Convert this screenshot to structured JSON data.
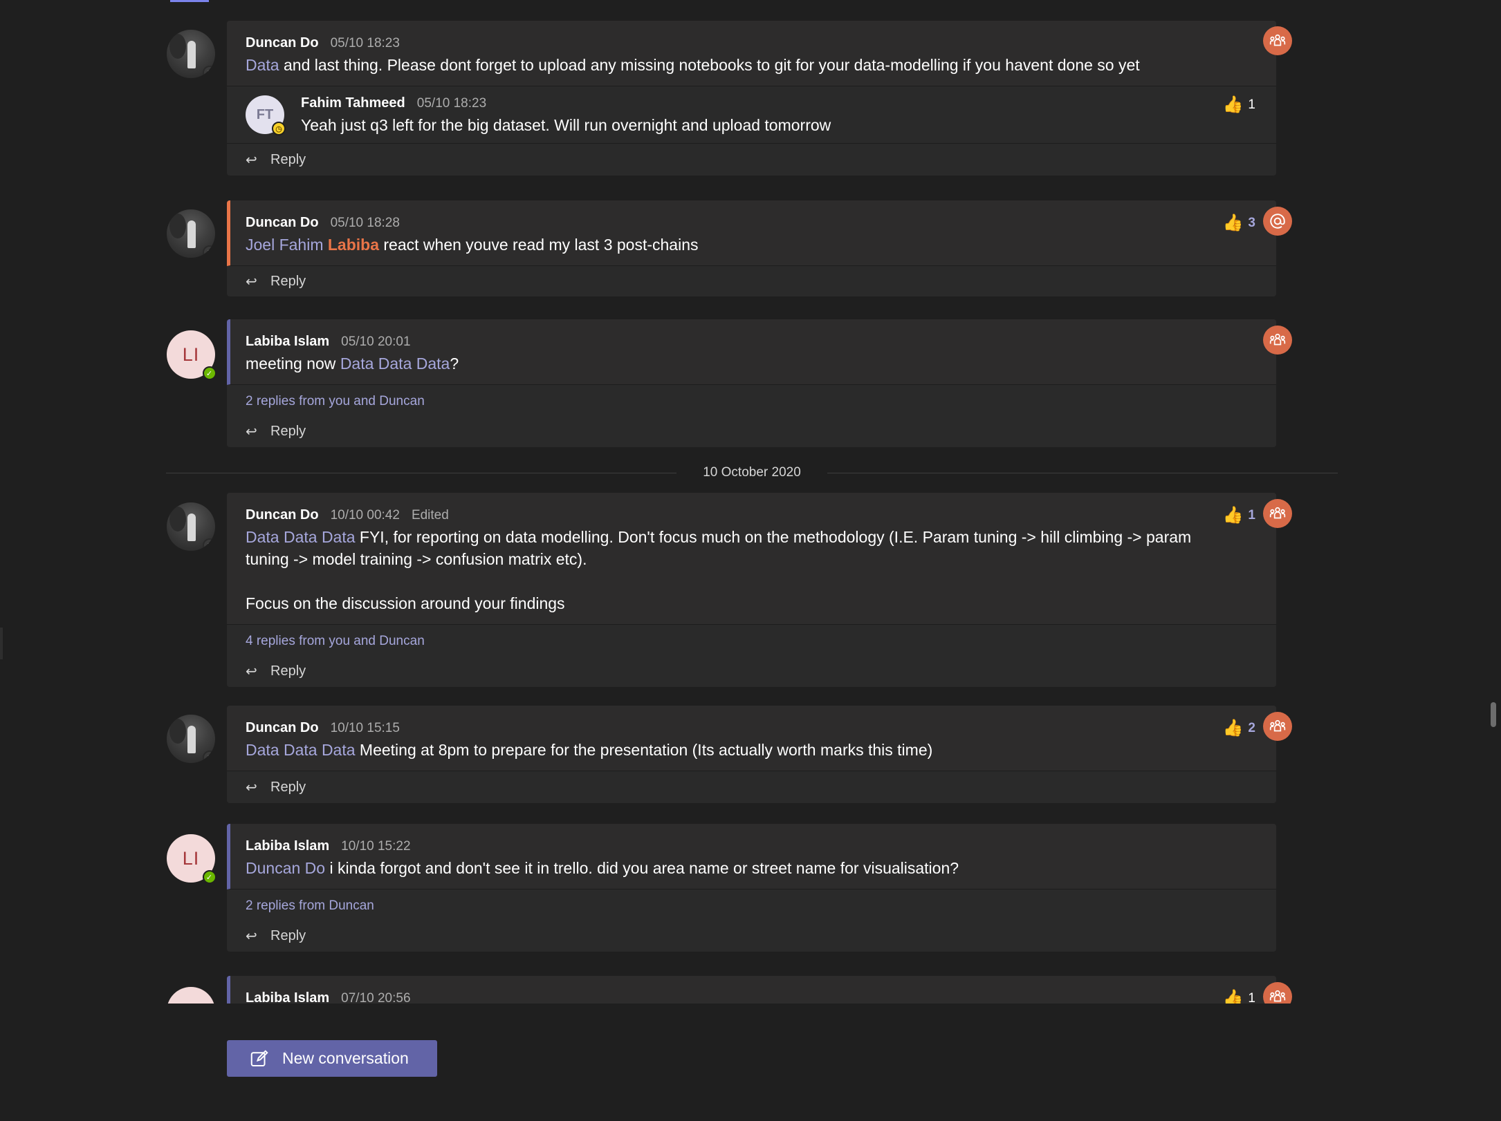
{
  "date_divider": "10 October 2020",
  "new_conversation_label": "New conversation",
  "reply_label": "Reply",
  "posts": [
    {
      "author": "Duncan Do",
      "time": "05/10 18:23",
      "mention": "Data",
      "text": " and last thing. Please dont forget to upload any missing notebooks to git for your data-modelling if you havent done so yet",
      "replies": [
        {
          "initials": "FT",
          "author": "Fahim Tahmeed",
          "time": "05/10 18:23",
          "text": "Yeah just q3 left for the big dataset. Will run overnight and upload tomorrow",
          "reaction_count": "1"
        }
      ]
    },
    {
      "author": "Duncan Do",
      "time": "05/10 18:28",
      "mention_a": "Joel Fahim ",
      "mention_me": "Labiba",
      "text": " react when youve read my last 3 post-chains",
      "reaction_count": "3"
    },
    {
      "author": "Labiba Islam",
      "initials": "LI",
      "time": "05/10 20:01",
      "prefix": "meeting now ",
      "mention": "Data Data Data",
      "suffix": "?",
      "thread_summary": "2 replies from you and Duncan"
    },
    {
      "author": "Duncan Do",
      "time": "10/10 00:42",
      "edited": "Edited",
      "mention": "Data Data Data",
      "text": " FYI, for reporting on data modelling. Don't focus much on the methodology (I.E. Param tuning -> hill climbing -> param tuning -> model training -> confusion matrix etc).",
      "text2": "Focus on the discussion around your findings",
      "reaction_count": "1",
      "thread_summary": "4 replies from you and Duncan"
    },
    {
      "author": "Duncan Do",
      "time": "10/10 15:15",
      "mention": "Data Data Data",
      "text": " Meeting at 8pm to prepare for the presentation (Its actually worth marks this time)",
      "reaction_count": "2"
    },
    {
      "author": "Labiba Islam",
      "initials": "LI",
      "time": "10/10 15:22",
      "mention": "Duncan Do",
      "text": " i kinda forgot and don't see it in trello. did you area name or street name for visualisation?",
      "thread_summary": "2 replies from Duncan"
    },
    {
      "author": "Labiba Islam",
      "time": "07/10 20:56",
      "reaction_count": "1"
    }
  ],
  "icons": {
    "channel_badge": "team-icon",
    "mention_badge": "at-mention-icon",
    "reaction": "thumbs-up-icon",
    "reply": "reply-arrow-icon",
    "compose": "compose-icon"
  },
  "colors": {
    "accent": "#6264a7",
    "mention": "#a6a7dc",
    "important": "#e97548",
    "badge": "#d86a48"
  }
}
